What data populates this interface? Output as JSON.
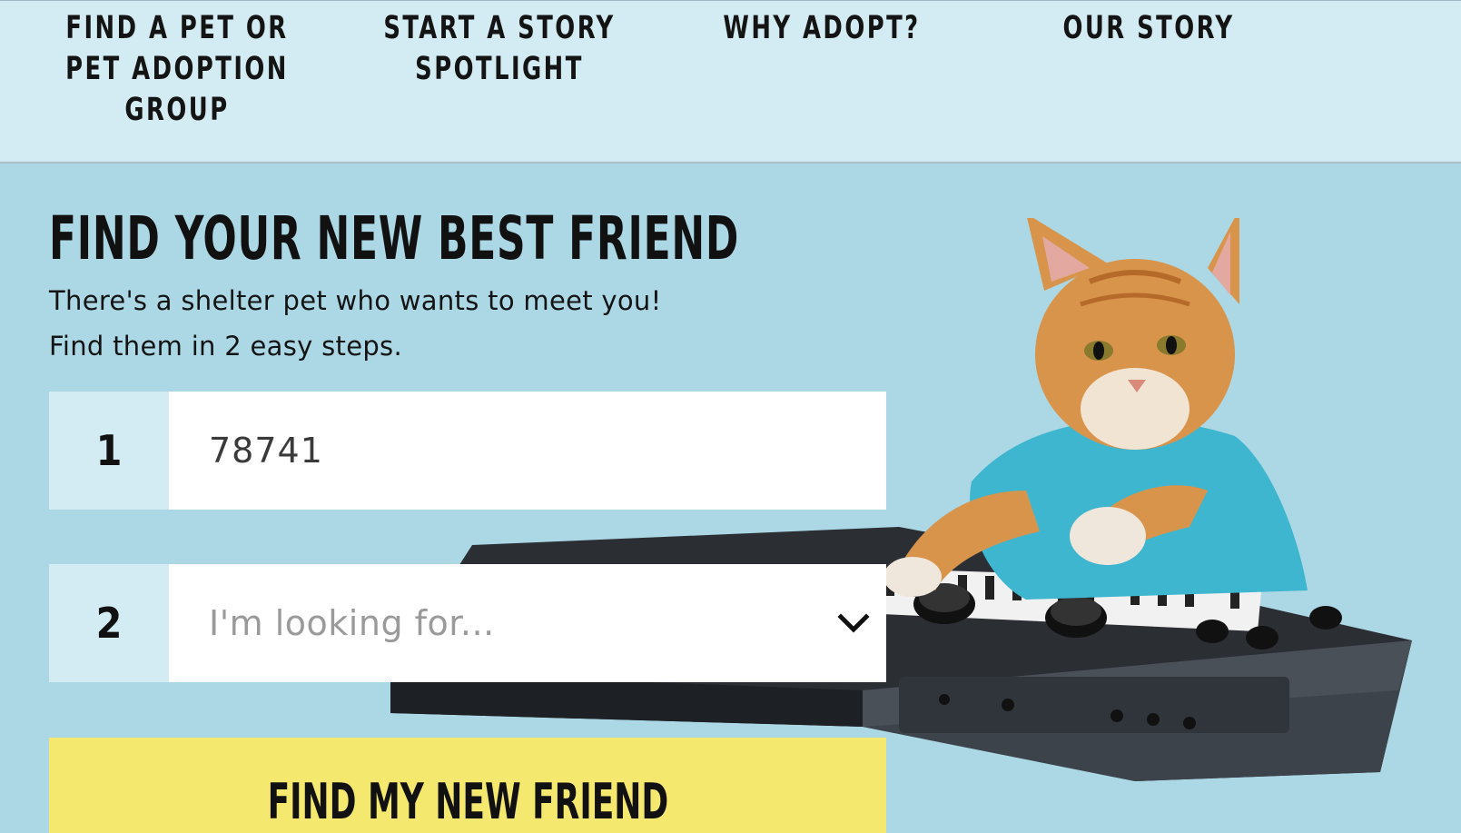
{
  "nav": {
    "items": [
      {
        "label": "FIND A PET OR PET ADOPTION GROUP"
      },
      {
        "label": "START A STORY SPOTLIGHT"
      },
      {
        "label": "WHY ADOPT?"
      },
      {
        "label": "OUR STORY"
      }
    ]
  },
  "hero": {
    "title": "FIND YOUR NEW BEST FRIEND",
    "subtitle_line1": "There's a shelter pet who wants to meet you!",
    "subtitle_line2": "Find them in 2 easy steps.",
    "step1": {
      "number": "1",
      "value": "78741"
    },
    "step2": {
      "number": "2",
      "placeholder": "I'm looking for..."
    },
    "cta_label": "FIND MY NEW FRIEND"
  },
  "colors": {
    "nav_bg": "#d3ebf3",
    "hero_bg": "#acd8e6",
    "cta_bg": "#f4e86f",
    "shirt": "#3fb6cf",
    "cat_fur": "#d8944a"
  },
  "icons": {
    "select": "chevron-down-icon"
  }
}
